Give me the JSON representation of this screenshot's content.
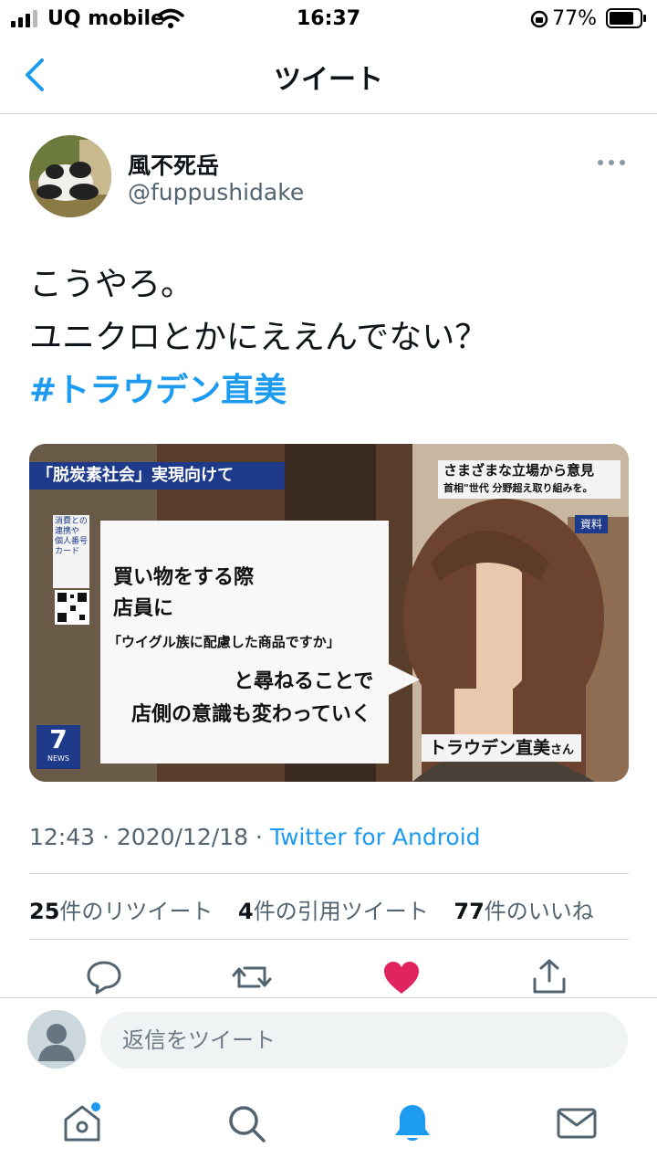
{
  "status_bar": {
    "carrier": "UQ mobile",
    "time": "16:37",
    "battery": "77%"
  },
  "header": {
    "title": "ツイート",
    "back_icon": "chevron-left-icon"
  },
  "tweet": {
    "author_name": "風不死岳",
    "author_handle": "@fuppushidake",
    "lines": [
      "こうやろ。",
      "ユニクロとかにええんでない？"
    ],
    "hashtag": "#トラウデン直美",
    "timestamp": "12:43 · 2020/12/18 · ",
    "source": "Twitter for Android",
    "retweets_count": "25",
    "retweets_label": "件のリツイート",
    "quotes_count": "4",
    "quotes_label": "件の引用ツイート",
    "likes_count": "77",
    "likes_label": "件のいいね"
  },
  "media": {
    "top_banner": "「脱炭素社会」実現向けて",
    "top_right_line1": "さまざまな立場から意見",
    "top_right_line2": "首相\"世代 分野超え取り組みを。",
    "tag": "資料",
    "side_text": "消費との連携や 個人番号カード",
    "quote_line1": "買い物をする際",
    "quote_line2": "店員に",
    "quote_line3": "「ウイグル族に配慮した商品ですか」",
    "quote_line4": "と尋ねることで",
    "quote_line5": "店側の意識も変わっていく",
    "name_caption": "トラウデン直美",
    "name_suffix": "さん",
    "logo_number": "7",
    "logo_word": "NEWS"
  },
  "reply": {
    "placeholder": "返信をツイート"
  },
  "colors": {
    "accent": "#1d9bf0",
    "like": "#e0245e",
    "muted": "#536471",
    "divider": "#d4d9dd"
  }
}
